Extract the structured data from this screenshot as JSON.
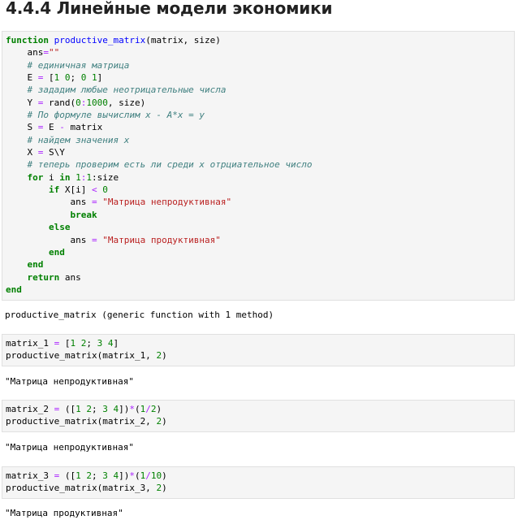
{
  "heading": "4.4.4 Линейные модели экономики",
  "cell1": {
    "l1": {
      "kw": "function",
      "fn": "productive_matrix",
      "rest": "(matrix, size)"
    },
    "l2": {
      "a": "    ans",
      "b": "=",
      "c": "\"\""
    },
    "l3": "    # единичная матрица",
    "l4": {
      "a": "    E ",
      "b": "=",
      "c": " [",
      "d": "1",
      "e": " ",
      "f": "0",
      "g": "; ",
      "h": "0",
      "i": " ",
      "j": "1",
      "k": "]"
    },
    "l5": "    # зададим любые неотрицательные числа",
    "l6": {
      "a": "    Y ",
      "b": "=",
      "c": " rand(",
      "d": "0",
      "e": ":",
      "f": "1000",
      "g": ", size)"
    },
    "l7": "    # По формуле вычислим x - A*x = y",
    "l8": {
      "a": "    S ",
      "b": "=",
      "c": " E ",
      "d": "-",
      "e": " matrix"
    },
    "l9": "    # найдем значения x",
    "l10": {
      "a": "    X ",
      "b": "=",
      "c": " S\\Y"
    },
    "l11": "    # теперь проверим есть ли среди x отрциательное число",
    "l12": {
      "a": "    ",
      "kw1": "for",
      "b": " i ",
      "kw2": "in",
      "c": " ",
      "d": "1",
      "e": ":",
      "f": "1",
      "g": ":size"
    },
    "l13": {
      "a": "        ",
      "kw": "if",
      "b": " X[i] ",
      "c": "<",
      "d": " ",
      "e": "0"
    },
    "l14": {
      "a": "            ans ",
      "b": "=",
      "c": " ",
      "d": "\"Матрица непродуктивная\""
    },
    "l15": {
      "a": "            ",
      "kw": "break"
    },
    "l16": {
      "a": "        ",
      "kw": "else"
    },
    "l17": {
      "a": "            ans ",
      "b": "=",
      "c": " ",
      "d": "\"Матрица продуктивная\""
    },
    "l18": {
      "a": "        ",
      "kw": "end"
    },
    "l19": {
      "a": "    ",
      "kw": "end"
    },
    "l20": {
      "a": "    ",
      "kw": "return",
      "b": " ans"
    },
    "l21": "end"
  },
  "out1": "productive_matrix (generic function with 1 method)",
  "cell2": {
    "l1": {
      "a": "matrix_1 ",
      "b": "=",
      "c": " [",
      "d": "1",
      "e": " ",
      "f": "2",
      "g": "; ",
      "h": "3",
      "i": " ",
      "j": "4",
      "k": "]"
    },
    "l2": {
      "a": "productive_matrix(matrix_1, ",
      "b": "2",
      "c": ")"
    }
  },
  "out2": "\"Матрица непродуктивная\"",
  "cell3": {
    "l1": {
      "a": "matrix_2 ",
      "b": "=",
      "c": " ([",
      "d": "1",
      "e": " ",
      "f": "2",
      "g": "; ",
      "h": "3",
      "i": " ",
      "j": "4",
      "k": "])",
      "l": "*",
      "m": "(",
      "n": "1",
      "o": "/",
      "p": "2",
      "q": ")"
    },
    "l2": {
      "a": "productive_matrix(matrix_2, ",
      "b": "2",
      "c": ")"
    }
  },
  "out3": "\"Матрица непродуктивная\"",
  "cell4": {
    "l1": {
      "a": "matrix_3 ",
      "b": "=",
      "c": " ([",
      "d": "1",
      "e": " ",
      "f": "2",
      "g": "; ",
      "h": "3",
      "i": " ",
      "j": "4",
      "k": "])",
      "l": "*",
      "m": "(",
      "n": "1",
      "o": "/",
      "p": "10",
      "q": ")"
    },
    "l2": {
      "a": "productive_matrix(matrix_3, ",
      "b": "2",
      "c": ")"
    }
  },
  "out4": "\"Матрица продуктивная\"",
  "colors": {
    "keyword": "#008000",
    "function": "#0000ff",
    "comment": "#408080",
    "string": "#ba2121",
    "operator": "#aa22ff",
    "cell_bg": "#f5f5f5"
  }
}
